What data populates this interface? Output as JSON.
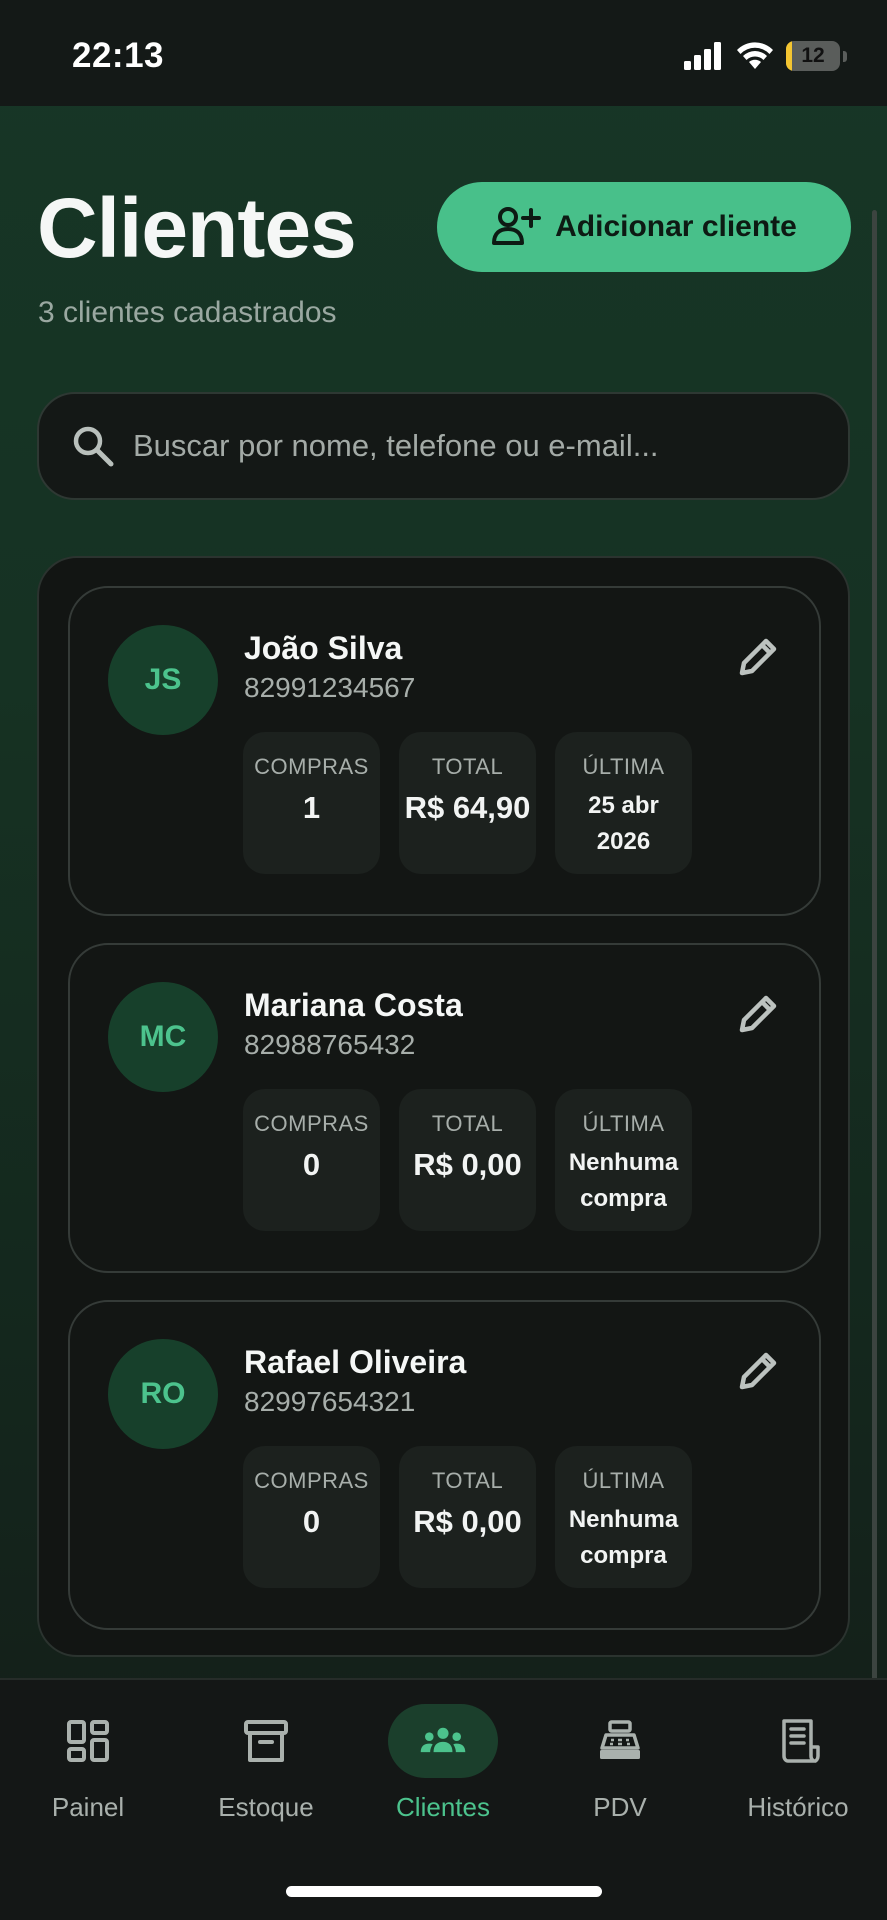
{
  "status_bar": {
    "time": "22:13",
    "battery": "12",
    "battery_level": 0.12
  },
  "header": {
    "title": "Clientes",
    "subtitle": "3 clientes cadastrados",
    "add_button_label": "Adicionar cliente"
  },
  "search": {
    "placeholder": "Buscar por nome, telefone ou e-mail..."
  },
  "stat_labels": {
    "purchases": "COMPRAS",
    "total": "TOTAL",
    "last": "ÚLTIMA"
  },
  "clients": [
    {
      "initials": "JS",
      "name": "João Silva",
      "phone": "82991234567",
      "purchases": "1",
      "total": "R$ 64,90",
      "last": "25 abr 2026"
    },
    {
      "initials": "MC",
      "name": "Mariana Costa",
      "phone": "82988765432",
      "purchases": "0",
      "total": "R$ 0,00",
      "last": "Nenhuma compra"
    },
    {
      "initials": "RO",
      "name": "Rafael Oliveira",
      "phone": "82997654321",
      "purchases": "0",
      "total": "R$ 0,00",
      "last": "Nenhuma compra"
    }
  ],
  "nav": {
    "items": [
      {
        "label": "Painel",
        "icon": "dashboard-icon",
        "active": false
      },
      {
        "label": "Estoque",
        "icon": "archive-box-icon",
        "active": false
      },
      {
        "label": "Clientes",
        "icon": "users-icon",
        "active": true
      },
      {
        "label": "PDV",
        "icon": "cash-register-icon",
        "active": false
      },
      {
        "label": "Histórico",
        "icon": "receipt-icon",
        "active": false
      }
    ]
  },
  "colors": {
    "accent": "#48c08a",
    "background": "#141917",
    "card": "#131614"
  }
}
